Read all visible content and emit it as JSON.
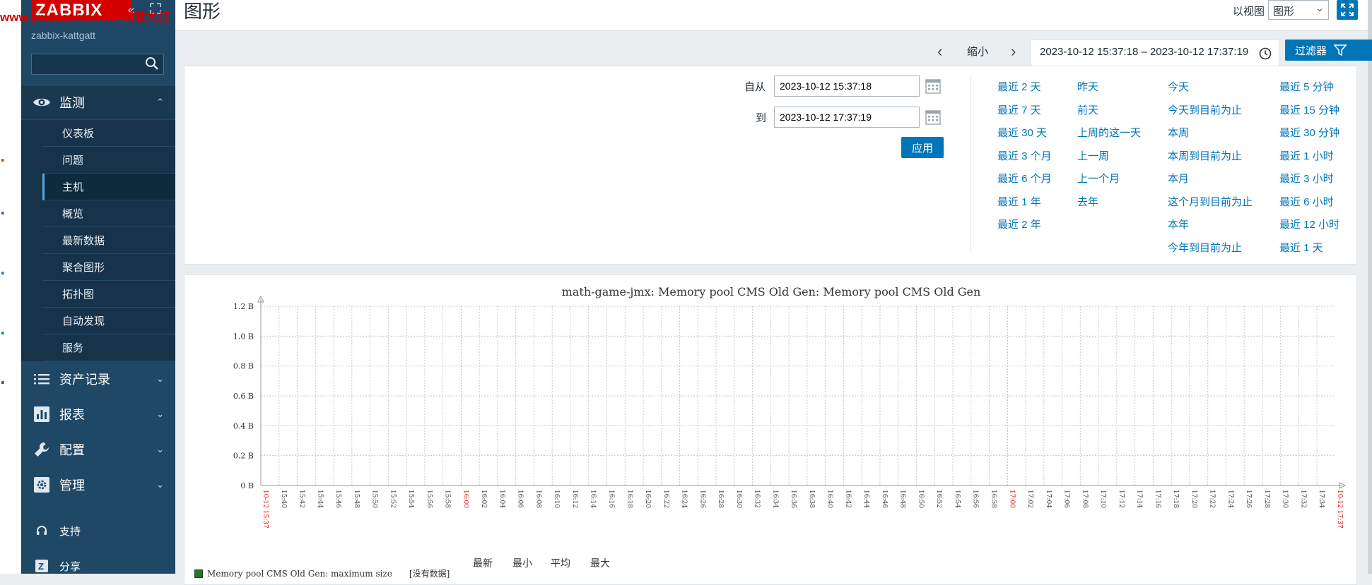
{
  "watermark": "www.ymzdashu.com-刻意大叔",
  "brand": {
    "logo": "ZABBIX",
    "hostname": "zabbix-kattgatt"
  },
  "sidebar": {
    "monitor": {
      "label": "监测",
      "chevron": "⌃"
    },
    "monitor_items": [
      {
        "label": "仪表板"
      },
      {
        "label": "问题"
      },
      {
        "label": "主机"
      },
      {
        "label": "概览"
      },
      {
        "label": "最新数据"
      },
      {
        "label": "聚合图形"
      },
      {
        "label": "拓扑图"
      },
      {
        "label": "自动发现"
      },
      {
        "label": "服务"
      }
    ],
    "groups": [
      {
        "label": "资产记录",
        "chevron": "⌄"
      },
      {
        "label": "报表",
        "chevron": "⌄"
      },
      {
        "label": "配置",
        "chevron": "⌄"
      },
      {
        "label": "管理",
        "chevron": "⌄"
      }
    ],
    "support": {
      "label": "支持"
    },
    "share": {
      "label": "分享"
    }
  },
  "header": {
    "title": "图形",
    "view_as_label": "以视图",
    "view_as_value": "图形"
  },
  "timebar": {
    "zoom_out": "缩小",
    "range": "2023-10-12 15:37:18 – 2023-10-12 17:37:19",
    "filter_label": "过滤器"
  },
  "filter": {
    "from_label": "自从",
    "from_value": "2023-10-12 15:37:18",
    "to_label": "到",
    "to_value": "2023-10-12 17:37:19",
    "apply_label": "应用",
    "quick_cols": [
      [
        "最近 2 天",
        "最近 7 天",
        "最近 30 天",
        "最近 3 个月",
        "最近 6 个月",
        "最近 1 年",
        "最近 2 年"
      ],
      [
        "昨天",
        "前天",
        "上周的这一天",
        "上一周",
        "上一个月",
        "去年"
      ],
      [
        "今天",
        "今天到目前为止",
        "本周",
        "本周到目前为止",
        "本月",
        "这个月到目前为止",
        "本年",
        "今年到目前为止"
      ],
      [
        "最近 5 分钟",
        "最近 15 分钟",
        "最近 30 分钟",
        "最近 1 小时",
        "最近 3 小时",
        "最近 6 小时",
        "最近 12 小时",
        "最近 1 天"
      ]
    ]
  },
  "graph": {
    "legend_headers": [
      "最新",
      "最小",
      "平均",
      "最大"
    ],
    "legend_item": "Memory pool CMS Old Gen: maximum size",
    "legend_nodata": "[没有数据]"
  },
  "chart_data": {
    "type": "line",
    "title": "math-game-jmx: Memory pool CMS Old Gen: Memory pool CMS Old Gen",
    "y_ticks": [
      "0 B",
      "0.2 B",
      "0.4 B",
      "0.6 B",
      "0.8 B",
      "1.0 B",
      "1.2 B"
    ],
    "ylim": [
      0,
      1.2
    ],
    "x_ticks": [
      "10-12 15:37",
      "15:40",
      "15:42",
      "15:44",
      "15:46",
      "15:48",
      "15:50",
      "15:52",
      "15:54",
      "15:56",
      "15:58",
      "16:00",
      "16:02",
      "16:04",
      "16:06",
      "16:08",
      "16:10",
      "16:12",
      "16:14",
      "16:16",
      "16:18",
      "16:20",
      "16:22",
      "16:24",
      "16:26",
      "16:28",
      "16:30",
      "16:32",
      "16:34",
      "16:36",
      "16:38",
      "16:40",
      "16:42",
      "16:44",
      "16:46",
      "16:48",
      "16:50",
      "16:52",
      "16:54",
      "16:56",
      "16:58",
      "17:00",
      "17:02",
      "17:04",
      "17:06",
      "17:08",
      "17:10",
      "17:12",
      "17:14",
      "17:16",
      "17:18",
      "17:20",
      "17:22",
      "17:24",
      "17:26",
      "17:28",
      "17:30",
      "17:32",
      "17:34",
      "10-12 17:37"
    ],
    "highlight_ticks": [
      "10-12 15:37",
      "16:00",
      "17:00",
      "10-12 17:37"
    ],
    "grid": true,
    "series": [
      {
        "name": "Memory pool CMS Old Gen: maximum size",
        "values": [],
        "color": "#1a7c1a"
      }
    ]
  },
  "colors": {
    "accent": "#0275b8",
    "sidebar": "#1f4867",
    "logo": "#d40000",
    "highlight_tick": "#d40000"
  }
}
